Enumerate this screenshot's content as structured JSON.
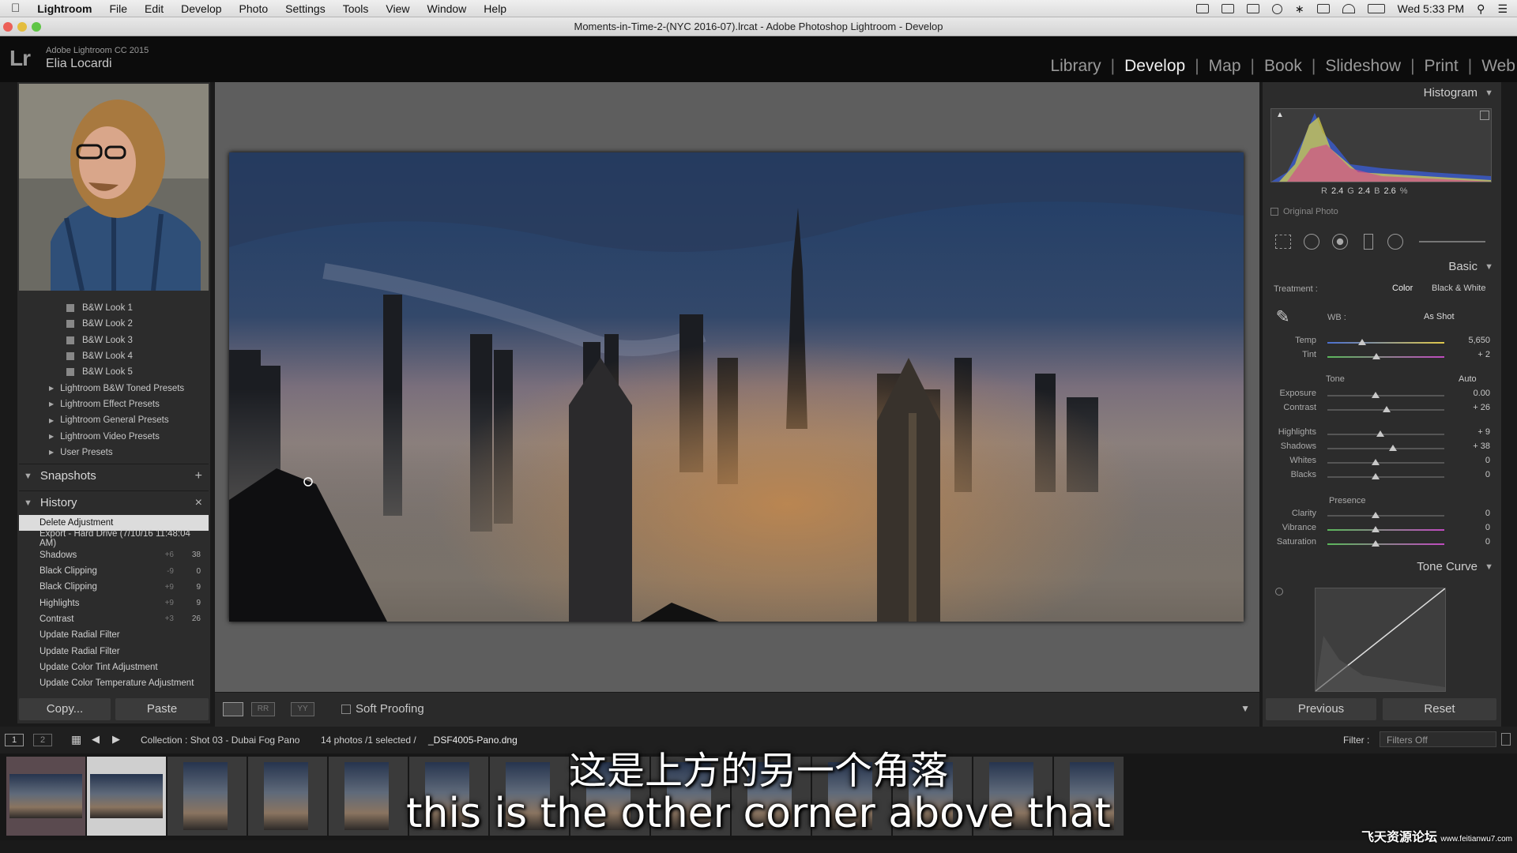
{
  "menubar": {
    "app": "Lightroom",
    "items": [
      "File",
      "Edit",
      "Develop",
      "Photo",
      "Settings",
      "Tools",
      "View",
      "Window",
      "Help"
    ],
    "clock": "Wed 5:33 PM"
  },
  "window": {
    "title": "Moments-in-Time-2-(NYC 2016-07).lrcat - Adobe Photoshop Lightroom - Develop"
  },
  "identity": {
    "logo": "Lr",
    "version": "Adobe Lightroom CC 2015",
    "user": "Elia Locardi"
  },
  "modules": [
    "Library",
    "Develop",
    "Map",
    "Book",
    "Slideshow",
    "Print",
    "Web"
  ],
  "active_module": "Develop",
  "presets": {
    "items": [
      "B&W Look 1",
      "B&W Look 2",
      "B&W Look 3",
      "B&W Look 4",
      "B&W Look 5"
    ],
    "folders": [
      "Lightroom B&W Toned Presets",
      "Lightroom Effect Presets",
      "Lightroom General Presets",
      "Lightroom Video Presets",
      "User Presets"
    ]
  },
  "snapshots": {
    "title": "Snapshots",
    "action": "+"
  },
  "history": {
    "title": "History",
    "action": "×",
    "rows": [
      {
        "label": "Delete Adjustment",
        "v1": "",
        "v2": ""
      },
      {
        "label": "Export - Hard Drive (7/10/16 11:48:04 AM)",
        "v1": "",
        "v2": ""
      },
      {
        "label": "Shadows",
        "v1": "+6",
        "v2": "38"
      },
      {
        "label": "Black Clipping",
        "v1": "-9",
        "v2": "0"
      },
      {
        "label": "Black Clipping",
        "v1": "+9",
        "v2": "9"
      },
      {
        "label": "Highlights",
        "v1": "+9",
        "v2": "9"
      },
      {
        "label": "Contrast",
        "v1": "+3",
        "v2": "26"
      },
      {
        "label": "Update Radial Filter",
        "v1": "",
        "v2": ""
      },
      {
        "label": "Update Radial Filter",
        "v1": "",
        "v2": ""
      },
      {
        "label": "Update Color Tint Adjustment",
        "v1": "",
        "v2": ""
      },
      {
        "label": "Update Color Temperature Adjustment",
        "v1": "",
        "v2": ""
      }
    ]
  },
  "left_buttons": {
    "copy": "Copy...",
    "paste": "Paste"
  },
  "toolbar": {
    "soft_proofing": "Soft Proofing"
  },
  "histogram": {
    "title": "Histogram",
    "r_label": "R",
    "r": "2.4",
    "g_label": "G",
    "g": "2.4",
    "b_label": "B",
    "b": "2.6",
    "pct": "%",
    "original_photo": "Original Photo"
  },
  "basic": {
    "title": "Basic",
    "treatment_label": "Treatment :",
    "color": "Color",
    "bw": "Black & White",
    "wb_label": "WB :",
    "wb_value": "As Shot",
    "tone_label": "Tone",
    "auto": "Auto",
    "presence_label": "Presence",
    "sliders": [
      {
        "label": "Temp",
        "value": "5,650",
        "pos": 0.3
      },
      {
        "label": "Tint",
        "value": "+ 2",
        "pos": 0.42
      },
      {
        "label": "Exposure",
        "value": "0.00",
        "pos": 0.41
      },
      {
        "label": "Contrast",
        "value": "+ 26",
        "pos": 0.51
      },
      {
        "label": "Highlights",
        "value": "+ 9",
        "pos": 0.45
      },
      {
        "label": "Shadows",
        "value": "+ 38",
        "pos": 0.56
      },
      {
        "label": "Whites",
        "value": "0",
        "pos": 0.41
      },
      {
        "label": "Blacks",
        "value": "0",
        "pos": 0.41
      },
      {
        "label": "Clarity",
        "value": "0",
        "pos": 0.41
      },
      {
        "label": "Vibrance",
        "value": "0",
        "pos": 0.41
      },
      {
        "label": "Saturation",
        "value": "0",
        "pos": 0.41
      }
    ]
  },
  "tone_curve": {
    "title": "Tone Curve"
  },
  "right_buttons": {
    "previous": "Previous",
    "reset": "Reset"
  },
  "filmbar": {
    "page1": "1",
    "page2": "2",
    "collection": "Collection : Shot 03 - Dubai Fog Pano",
    "count": "14 photos /1 selected /",
    "filename": "_DSF4005-Pano.dng",
    "filter_label": "Filter :",
    "filter_value": "Filters Off"
  },
  "subtitles": {
    "cn": "这是上方的另一个角落",
    "en": "this is the other corner above that"
  },
  "watermark": {
    "text": "飞天资源论坛",
    "url": "www.feitianwu7.com"
  },
  "colors": {
    "accent": "#f0f0f0",
    "panel": "#2c2c2c",
    "selection": "#dcdcdc"
  }
}
